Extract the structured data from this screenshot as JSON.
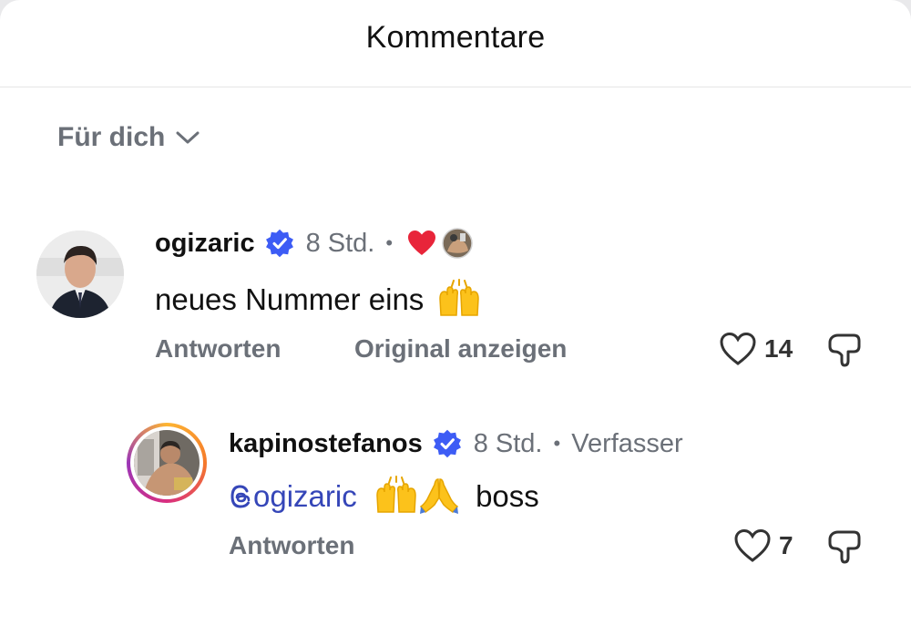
{
  "header": {
    "title": "Kommentare"
  },
  "filter": {
    "label": "Für dich"
  },
  "comments": [
    {
      "username": "ogizaric",
      "time": "8 Std.",
      "dot": "•",
      "text": "neues Nummer eins",
      "reply_label": "Antworten",
      "translate_label": "Original anzeigen",
      "likes": "14"
    },
    {
      "username": "kapinostefanos",
      "time": "8 Std.",
      "dot": "•",
      "tag": "Verfasser",
      "mention": "ogizaric",
      "text": "boss",
      "reply_label": "Antworten",
      "likes": "7"
    }
  ],
  "colors": {
    "verified": "#3d5cf5",
    "heart": "#e8253a",
    "mention": "#3546b8",
    "secondary_text": "#6b7078"
  }
}
